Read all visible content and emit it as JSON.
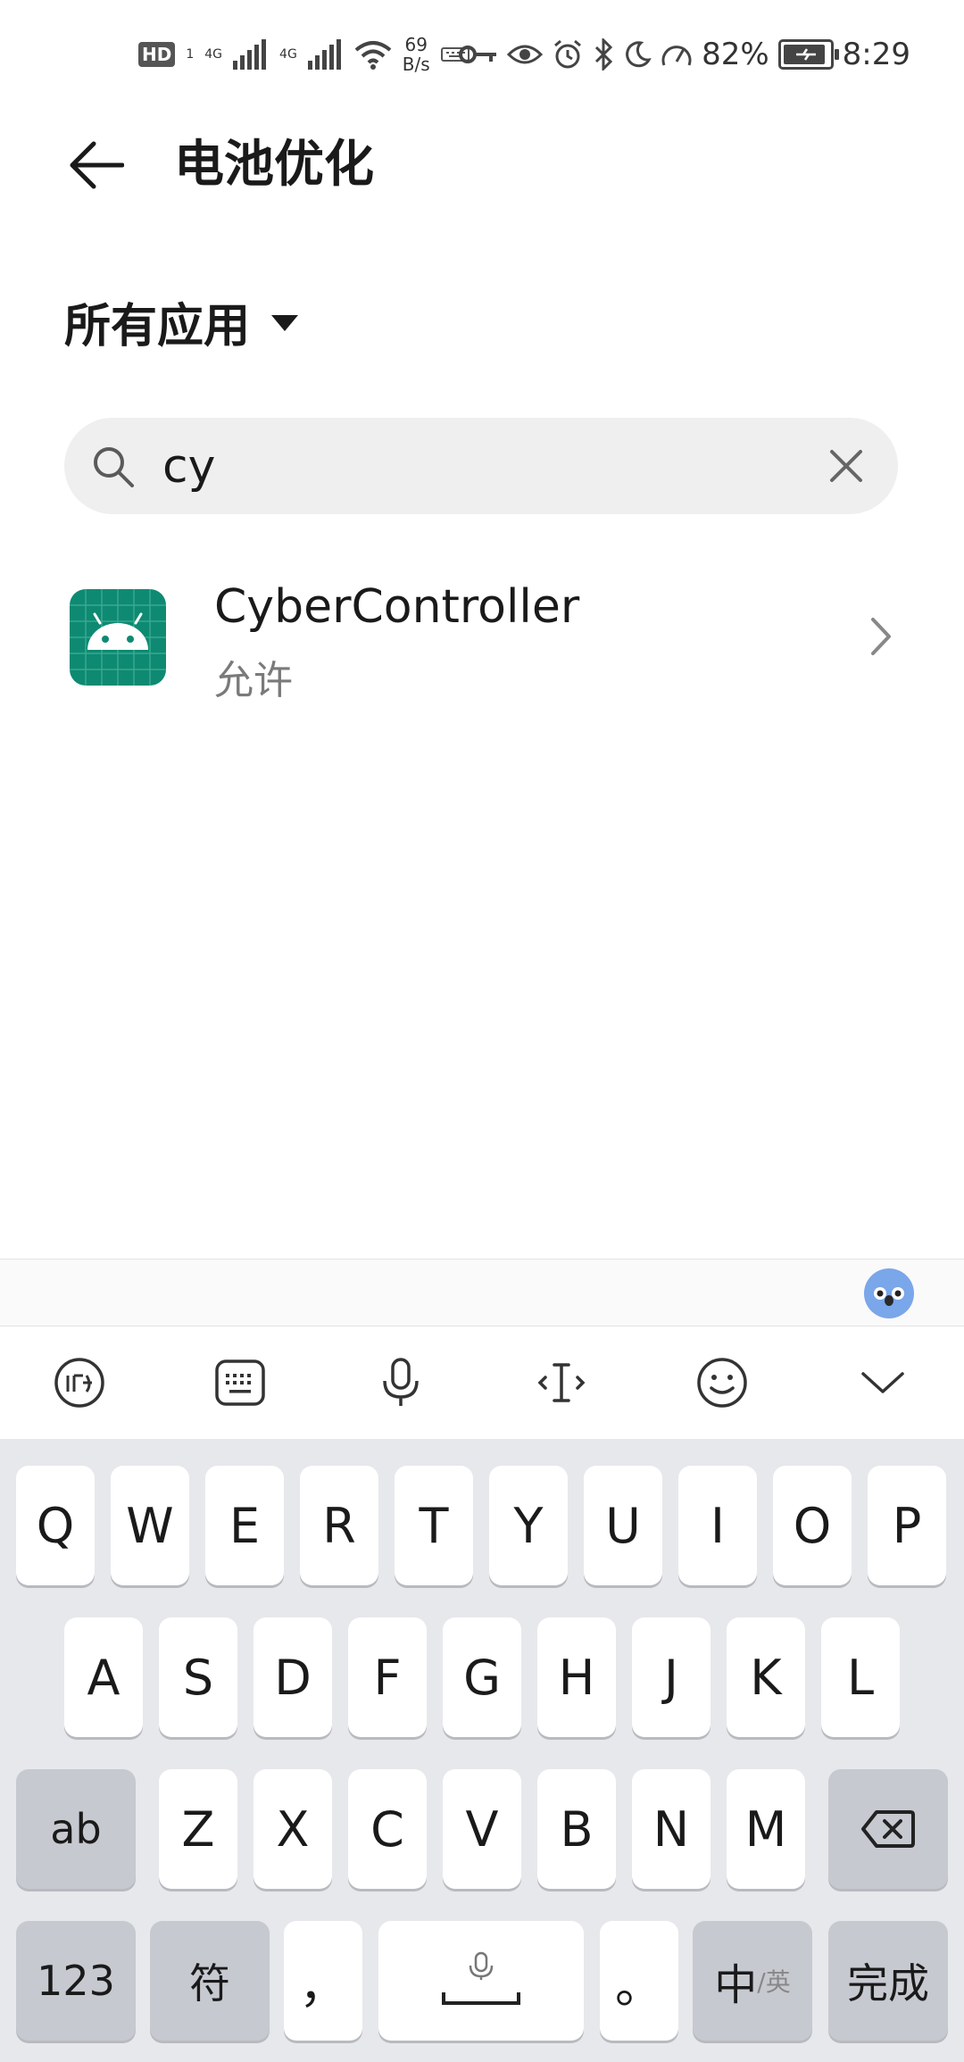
{
  "status_bar": {
    "hd_label": "HD",
    "sim_label": "1",
    "net1": "4G",
    "net2": "4G",
    "speed_value": "69",
    "speed_unit": "B/s",
    "battery_percent": "82%",
    "time": "8:29"
  },
  "header": {
    "title": "电池优化"
  },
  "filter": {
    "label": "所有应用"
  },
  "search": {
    "value": "cy"
  },
  "app_list": [
    {
      "name": "CyberController",
      "status": "允许"
    }
  ],
  "keyboard": {
    "row1": [
      "Q",
      "W",
      "E",
      "R",
      "T",
      "Y",
      "U",
      "I",
      "O",
      "P"
    ],
    "row2": [
      "A",
      "S",
      "D",
      "F",
      "G",
      "H",
      "J",
      "K",
      "L"
    ],
    "row3": [
      "Z",
      "X",
      "C",
      "V",
      "B",
      "N",
      "M"
    ],
    "shift_label": "ab",
    "num_label": "123",
    "symbol_label": "符",
    "comma": "，",
    "period": "。",
    "lang_main": "中",
    "lang_alt": "/英",
    "done_label": "完成"
  },
  "colors": {
    "app_icon_bg": "#0e8a72",
    "keyboard_bg": "#e7e8ec",
    "function_key_bg": "#c7c9d0",
    "search_bg": "#efefef"
  }
}
